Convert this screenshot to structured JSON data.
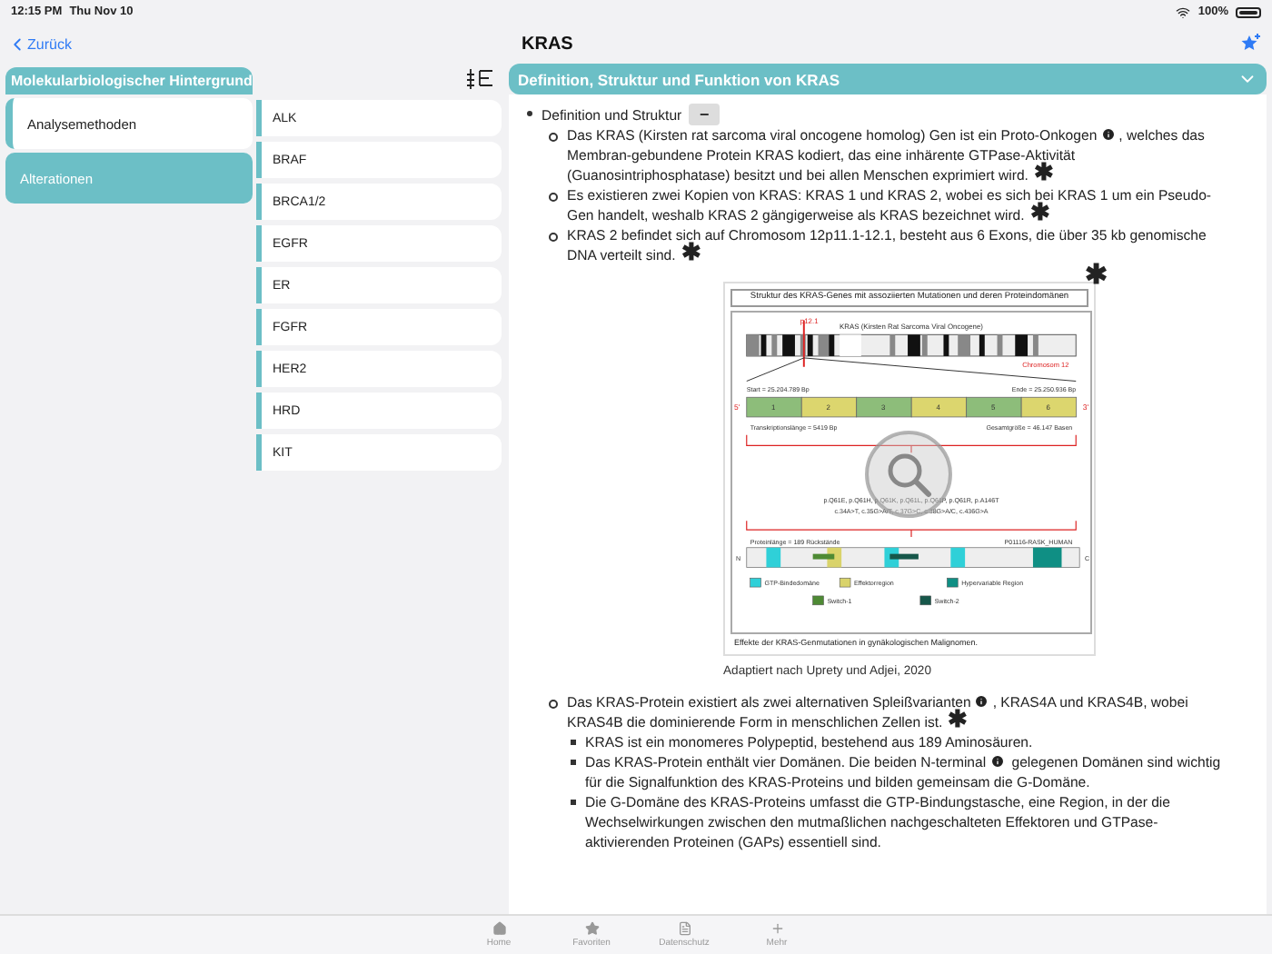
{
  "status_bar": {
    "time": "12:15 PM",
    "date": "Thu Nov 10",
    "battery": "100%"
  },
  "nav": {
    "back": "Zurück",
    "title": "KRAS"
  },
  "sidebar": {
    "header": "Molekularbiologischer Hintergrund",
    "items": [
      {
        "label": "Analysemethoden",
        "selected": false
      },
      {
        "label": "Alterationen",
        "selected": true
      }
    ]
  },
  "alterations": {
    "items": [
      {
        "label": "ALK"
      },
      {
        "label": "BRAF"
      },
      {
        "label": "BRCA1/2"
      },
      {
        "label": "EGFR"
      },
      {
        "label": "ER"
      },
      {
        "label": "FGFR"
      },
      {
        "label": "HER2"
      },
      {
        "label": "HRD"
      },
      {
        "label": "KIT"
      }
    ]
  },
  "section": {
    "title": "Definition, Struktur und Funktion von KRAS",
    "expanded": true,
    "bullet": "Definition und Struktur",
    "collapse": "−",
    "items": [
      {
        "before": "Das KRAS (Kirsten rat sarcoma viral oncogene homolog) Gen ist ein Proto-Onkogen",
        "after": ", welches das Membran-gebundene Protein KRAS kodiert, das eine inhärente GTPase-Aktivität (Guanosintriphosphatase) besitzt und bei allen Menschen exprimiert wird.",
        "star": "✱"
      },
      {
        "before": "Es existieren zwei Kopien von KRAS: KRAS 1 und KRAS 2, wobei es sich bei KRAS 1 um ein Pseudo-Gen handelt, weshalb KRAS 2 gängigerweise als KRAS bezeichnet wird.",
        "star": "✱"
      },
      {
        "before": "KRAS 2 befindet sich auf Chromosom 12p11.1-12.1, besteht aus 6 Exons, die über 35 kb genomische DNA verteilt sind.",
        "star": "✱"
      }
    ],
    "figure": {
      "title": "Struktur des KRAS-Genes mit assoziierten Mutationen und deren Proteindomänen",
      "gene": "KRAS (Kirsten Rat Sarcoma Viral Oncogene)",
      "band": "p12.1",
      "chromosome": "Chromosom 12",
      "start": "Start = 25.204.789 Bp",
      "end": "Ende = 25.250.936 Bp",
      "five": "5'",
      "three": "3'",
      "exons": [
        "1",
        "2",
        "3",
        "4",
        "5",
        "6"
      ],
      "transcript": "Transkriptionslänge = 5419 Bp",
      "size": "Gesamtgröße = 46.147 Basen",
      "mutations": [
        "p.Q61E, p.Q61H, p.Q61K, p.Q61L, p.Q61P, p.Q61R, p.A146T",
        "c.34A>T, c.35G>A/T, c.37G>C, c.38G>A/C, c.436G>A"
      ],
      "protein": "Proteinlänge = 189 Rückstände",
      "uniprot": "P01116-RASK_HUMAN",
      "n": "N",
      "c": "C",
      "legend": [
        {
          "label": "GTP-Bindedomäne",
          "color": "#2fd0d8"
        },
        {
          "label": "Effektorregion",
          "color": "#d9d36a"
        },
        {
          "label": "Hypervariable Region",
          "color": "#0f8f84"
        },
        {
          "label": "Switch-1",
          "color": "#4e8a34"
        },
        {
          "label": "Switch-2",
          "color": "#16574a"
        }
      ],
      "caption": "Effekte der KRAS-Genmutationen in gynäkologischen Malignomen.",
      "star": "✱"
    },
    "credit": "Adaptiert nach Uprety und Adjei, 2020",
    "item2": {
      "before": "Das KRAS-Protein existiert als zwei alternativen Spleißvarianten",
      "after": ", KRAS4A und KRAS4B, wobei KRAS4B die dominierende Form in menschlichen Zellen ist.",
      "star": "✱",
      "children": [
        {
          "before": "KRAS ist ein monomeres Polypeptid, bestehend aus 189 Aminosäuren."
        },
        {
          "before": "Das KRAS-Protein enthält vier Domänen. Die beiden N-terminal",
          "after": " gelegenen Domänen sind wichtig für die Signalfunktion des KRAS-Proteins und bilden gemeinsam die G-Domäne."
        },
        {
          "before": "Die G-Domäne des KRAS-Proteins umfasst die GTP-Bindungstasche, eine Region, in der die Wechselwirkungen zwischen den mutmaßlichen nachgeschalteten Effektoren und GTPase-aktivierenden Proteinen (GAPs) essentiell sind."
        }
      ]
    }
  },
  "tab_bar": {
    "items": [
      {
        "label": "Home",
        "kind": "home",
        "selected": false
      },
      {
        "label": "Favoriten",
        "kind": "star",
        "selected": false
      },
      {
        "label": "Datenschutz",
        "kind": "document",
        "selected": false
      },
      {
        "label": "Mehr",
        "kind": "plus",
        "selected": false
      }
    ]
  }
}
